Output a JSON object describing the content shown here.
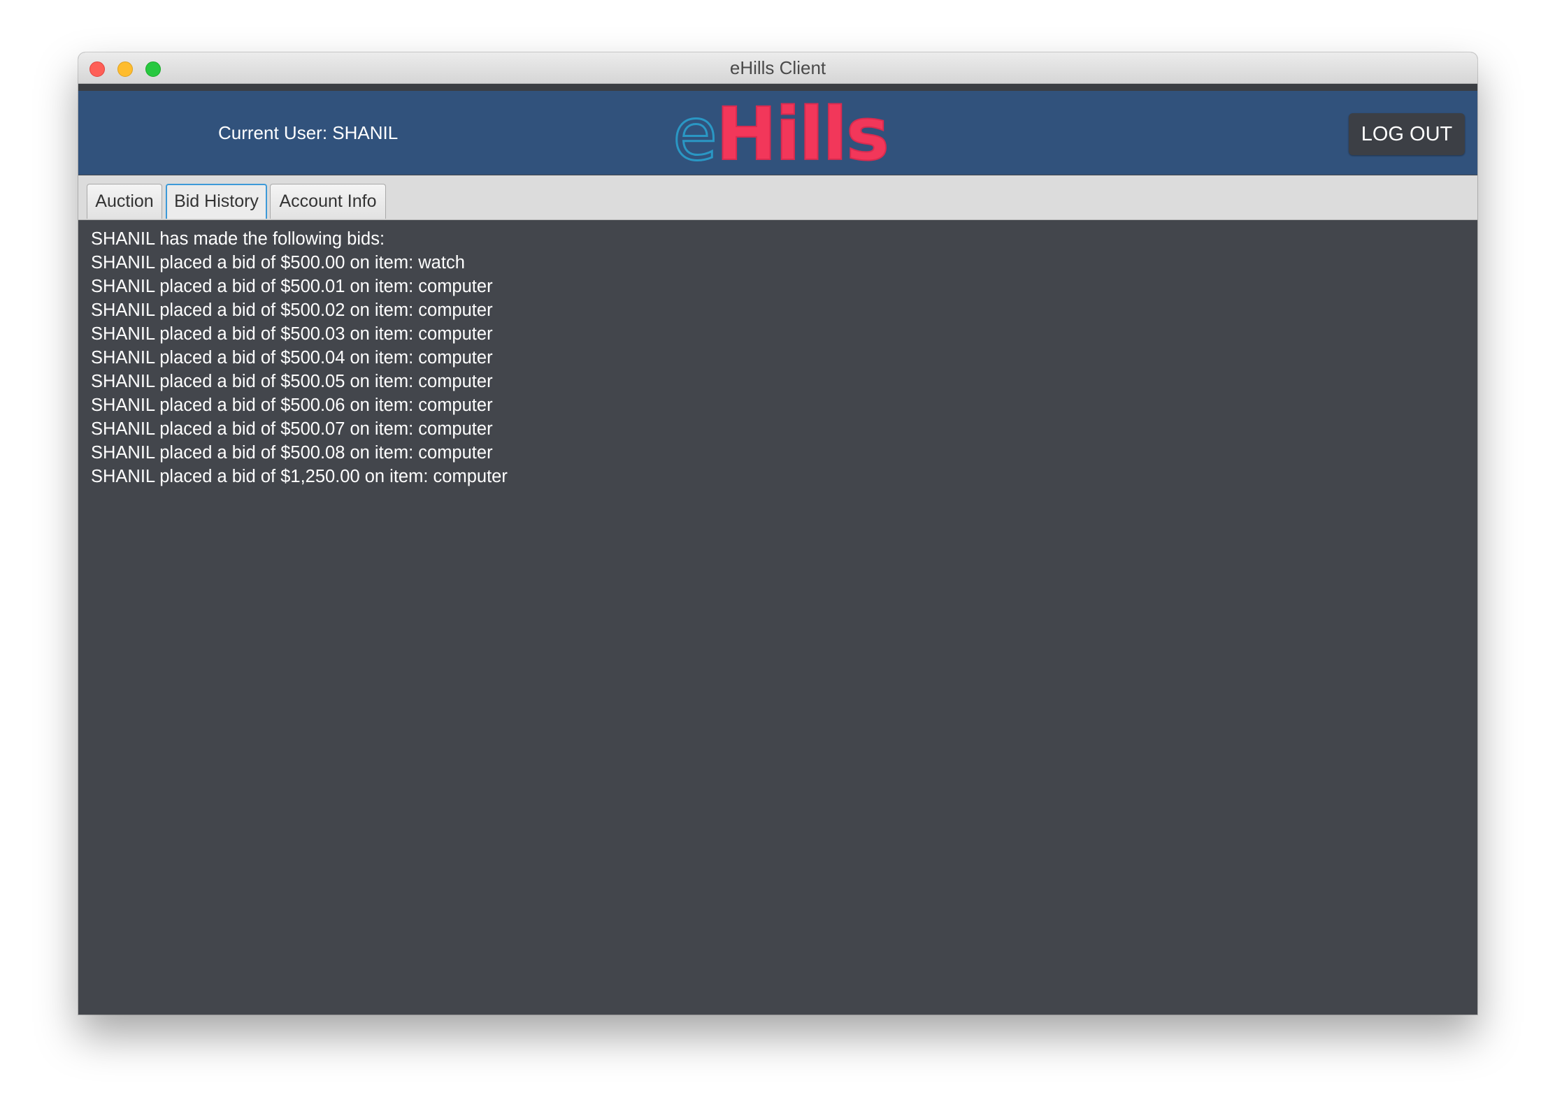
{
  "window": {
    "title": "eHills Client"
  },
  "header": {
    "current_user_label": "Current User: SHANIL",
    "logo_prefix": "e",
    "logo_main": "Hills",
    "logout_label": "LOG OUT"
  },
  "tabs": [
    {
      "label": "Auction",
      "active": false
    },
    {
      "label": "Bid History",
      "active": true
    },
    {
      "label": "Account Info",
      "active": false
    }
  ],
  "bid_history": {
    "heading": "SHANIL has made the following bids:",
    "entries": [
      "SHANIL placed a bid of $500.00 on item: watch",
      "SHANIL placed a bid of $500.01 on item: computer",
      "SHANIL placed a bid of $500.02 on item: computer",
      "SHANIL placed a bid of $500.03 on item: computer",
      "SHANIL placed a bid of $500.04 on item: computer",
      "SHANIL placed a bid of $500.05 on item: computer",
      "SHANIL placed a bid of $500.06 on item: computer",
      "SHANIL placed a bid of $500.07 on item: computer",
      "SHANIL placed a bid of $500.08 on item: computer",
      "SHANIL placed a bid of $1,250.00 on item: computer"
    ]
  },
  "colors": {
    "header_bg": "#31527c",
    "logo_e": "#2a97c4",
    "logo_hills": "#f2375a",
    "content_bg": "#43464c",
    "active_tab_border": "#3d9ad8"
  }
}
